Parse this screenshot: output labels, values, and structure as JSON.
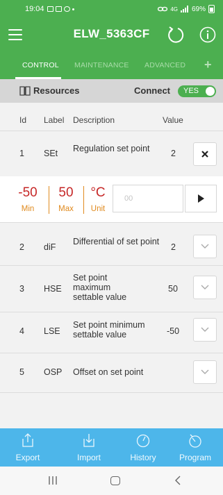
{
  "status_bar": {
    "time": "19:04",
    "battery_text": "69%",
    "signal_text": "4G"
  },
  "app_bar": {
    "title": "ELW_5363CF",
    "menu_icon": "hamburger-menu-icon",
    "refresh_icon": "refresh-icon",
    "info_icon": "info-icon"
  },
  "tabs": [
    {
      "label": "CONTROL",
      "active": true
    },
    {
      "label": "MAINTENANCE",
      "active": false
    },
    {
      "label": "ADVANCED",
      "active": false
    },
    {
      "label": "+",
      "active": false
    }
  ],
  "resources": {
    "label": "Resources",
    "icon": "book-icon",
    "connect_label": "Connect",
    "connect_value": "YES",
    "connected": true
  },
  "table": {
    "headers": {
      "id": "Id",
      "label": "Label",
      "description": "Description",
      "value": "Value"
    },
    "rows": [
      {
        "id": "1",
        "label": "SEt",
        "description": "Regulation set point",
        "value": "2",
        "action_icon": "close-icon",
        "expanded": true
      },
      {
        "id": "2",
        "label": "diF",
        "description": "Differential of set point",
        "value": "2",
        "action_icon": "chevron-down-icon",
        "expanded": false
      },
      {
        "id": "3",
        "label": "HSE",
        "description": "Set point maximum settable value",
        "value": "50",
        "action_icon": "chevron-down-icon",
        "expanded": false
      },
      {
        "id": "4",
        "label": "LSE",
        "description": "Set point minimum settable value",
        "value": "-50",
        "action_icon": "chevron-down-icon",
        "expanded": false
      },
      {
        "id": "5",
        "label": "OSP",
        "description": "Offset on set point",
        "value": "",
        "action_icon": "chevron-down-icon",
        "expanded": false
      }
    ]
  },
  "editor": {
    "min_value": "-50",
    "min_label": "Min",
    "max_value": "50",
    "max_label": "Max",
    "unit_value": "°C",
    "unit_label": "Unit",
    "input_placeholder": "00",
    "send_icon": "play-icon"
  },
  "bottom_nav": [
    {
      "label": "Export",
      "icon": "export-icon"
    },
    {
      "label": "Import",
      "icon": "import-icon"
    },
    {
      "label": "History",
      "icon": "history-icon"
    },
    {
      "label": "Program",
      "icon": "timer-icon"
    }
  ],
  "colors": {
    "primary_green": "#4caf50",
    "nav_blue": "#4db6ea",
    "min_max_red": "#c62828",
    "editor_orange": "#e08a1e"
  }
}
